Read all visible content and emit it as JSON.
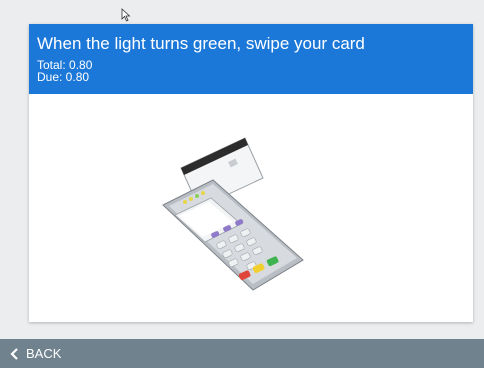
{
  "prompt": {
    "headline": "When the light turns green, swipe your card",
    "total": "Total: 0.80",
    "due": "Due: 0.80"
  },
  "footer": {
    "back_label": "BACK"
  },
  "colors": {
    "header_blue": "#1c78d8",
    "footer_gray": "#71828f",
    "page_bg": "#ebedef"
  },
  "icons": {
    "back": "chevron-left-icon",
    "terminal": "card-terminal-icon",
    "cursor": "mouse-cursor-icon"
  }
}
